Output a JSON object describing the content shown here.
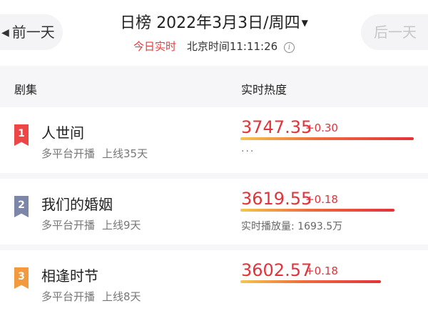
{
  "header": {
    "prev_label": "前一天",
    "next_label": "后一天",
    "board_name": "日榜",
    "date": "2022年3月3日/周四",
    "realtime_label": "今日实时",
    "clock_label": "北京时间",
    "clock_time": "11:11:26"
  },
  "columns": {
    "title_col": "剧集",
    "heat_col": "实时热度"
  },
  "rows": [
    {
      "rank": "1",
      "title": "人世间",
      "platform": "多平台开播",
      "online": "上线35天",
      "score": "3747.35",
      "delta": "+0.30",
      "extra": "···",
      "bar_fraction": 1.0,
      "badge_color": "#ec4646"
    },
    {
      "rank": "2",
      "title": "我们的婚姻",
      "platform": "多平台开播",
      "online": "上线9天",
      "score": "3619.55",
      "delta": "+0.18",
      "extra": "实时播放量:  1693.5万",
      "bar_fraction": 0.889,
      "badge_color": "#7b86a8"
    },
    {
      "rank": "3",
      "title": "相逢时节",
      "platform": "多平台开播",
      "online": "上线8天",
      "score": "3602.57",
      "delta": "+0.18",
      "extra": "",
      "bar_fraction": 0.809,
      "badge_color": "#f39a3e"
    }
  ]
}
